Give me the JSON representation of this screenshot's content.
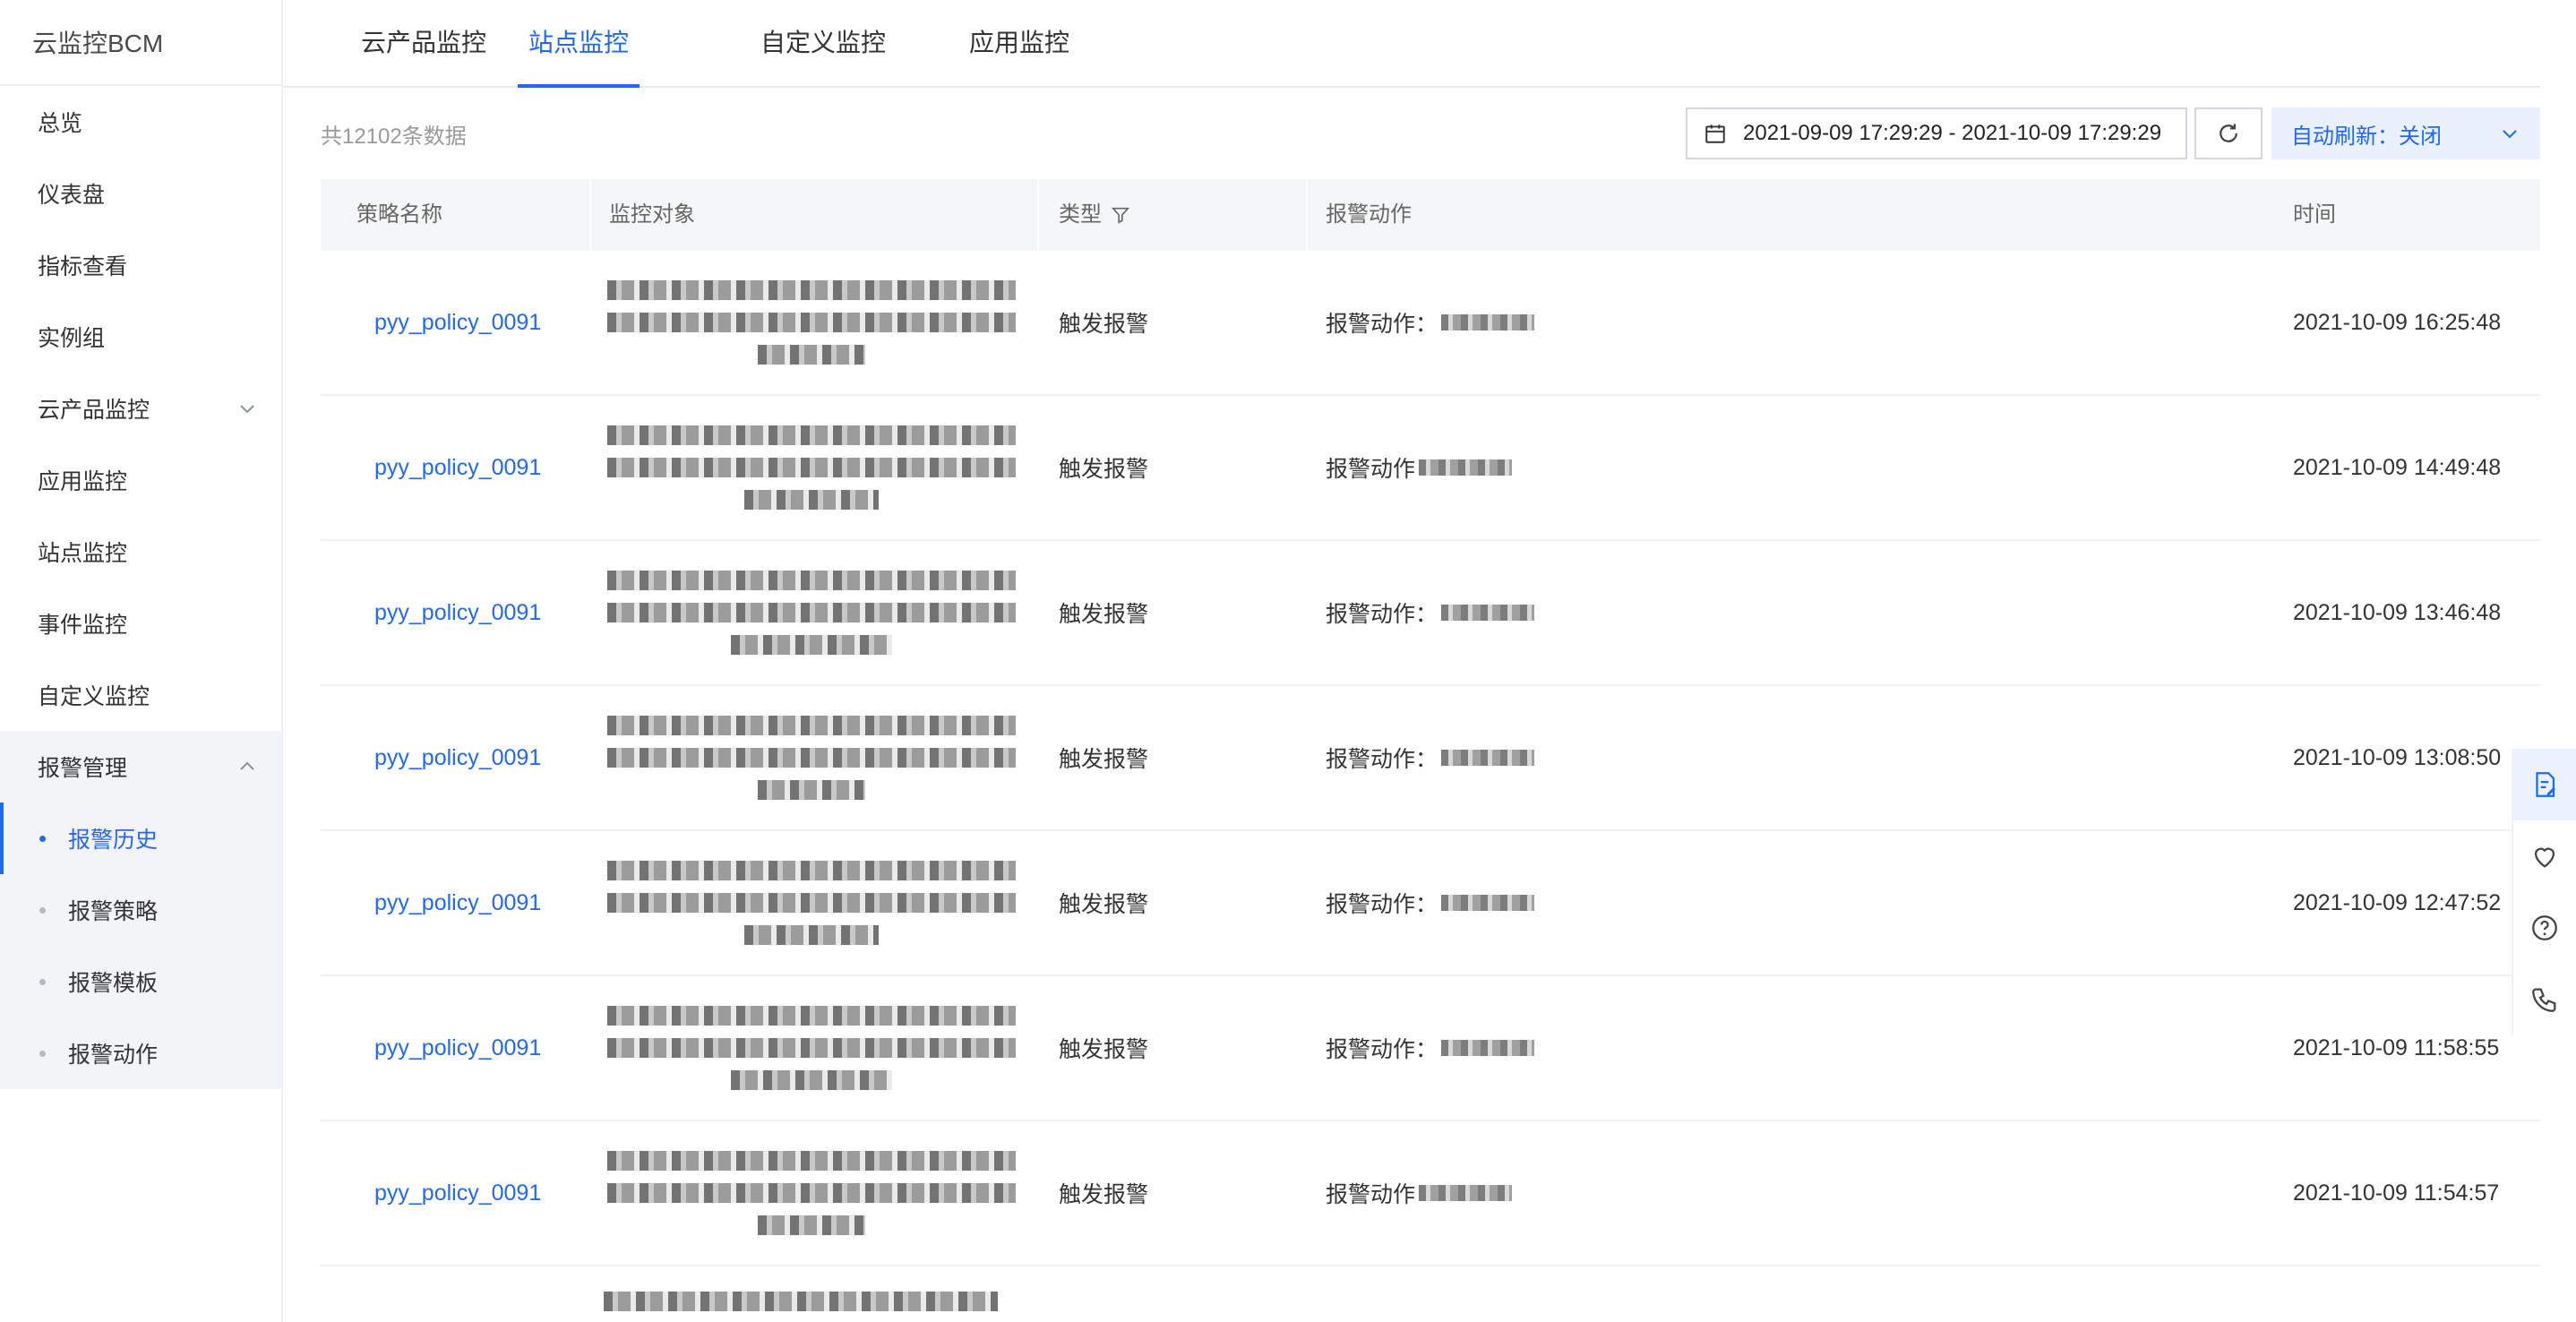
{
  "brand": "云监控BCM",
  "sidebar": {
    "items": [
      {
        "label": "总览"
      },
      {
        "label": "仪表盘"
      },
      {
        "label": "指标查看"
      },
      {
        "label": "实例组"
      },
      {
        "label": "云产品监控"
      },
      {
        "label": "应用监控"
      },
      {
        "label": "站点监控"
      },
      {
        "label": "事件监控"
      },
      {
        "label": "自定义监控"
      },
      {
        "label": "报警管理"
      }
    ],
    "alarm_sub": [
      {
        "label": "报警历史",
        "active": true
      },
      {
        "label": "报警策略"
      },
      {
        "label": "报警模板"
      },
      {
        "label": "报警动作"
      }
    ]
  },
  "tabs": [
    "云产品监控",
    "站点监控",
    "自定义监控",
    "应用监控"
  ],
  "active_tab": "站点监控",
  "toolbar": {
    "count": "共12102条数据",
    "date_range": "2021-09-09 17:29:29 - 2021-10-09 17:29:29",
    "auto_refresh": "自动刷新：关闭"
  },
  "table": {
    "columns": [
      "策略名称",
      "监控对象",
      "类型",
      "报警动作",
      "时间"
    ],
    "rows": [
      {
        "policy": "pyy_policy_0091",
        "type": "触发报警",
        "action": "报警动作：",
        "time": "2021-10-09 16:25:48"
      },
      {
        "policy": "pyy_policy_0091",
        "type": "触发报警",
        "action": "报警动作",
        "time": "2021-10-09 14:49:48"
      },
      {
        "policy": "pyy_policy_0091",
        "type": "触发报警",
        "action": "报警动作：",
        "time": "2021-10-09 13:46:48"
      },
      {
        "policy": "pyy_policy_0091",
        "type": "触发报警",
        "action": "报警动作：",
        "time": "2021-10-09 13:08:50"
      },
      {
        "policy": "pyy_policy_0091",
        "type": "触发报警",
        "action": "报警动作：",
        "time": "2021-10-09 12:47:52"
      },
      {
        "policy": "pyy_policy_0091",
        "type": "触发报警",
        "action": "报警动作：",
        "time": "2021-10-09 11:58:55"
      },
      {
        "policy": "pyy_policy_0091",
        "type": "触发报警",
        "action": "报警动作",
        "time": "2021-10-09 11:54:57"
      }
    ]
  },
  "colors": {
    "accent": "#2468f2",
    "sidebar_group_bg": "#f2f4f8",
    "header_bg": "#f5f6f8"
  },
  "float_icons": [
    "edit-document-icon",
    "heart-icon",
    "help-icon",
    "phone-icon"
  ]
}
